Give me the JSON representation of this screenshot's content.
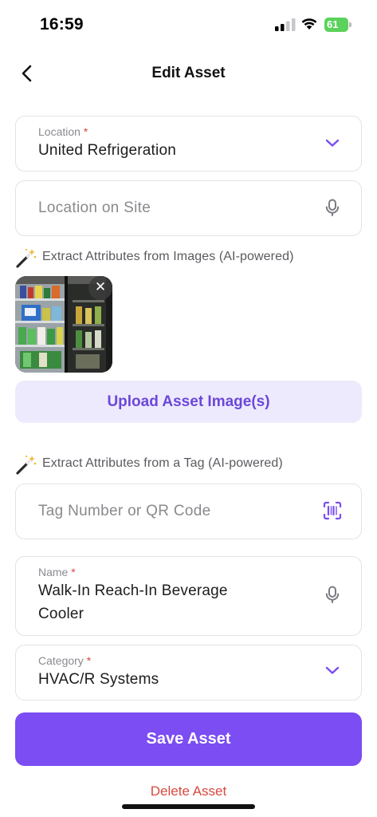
{
  "status_bar": {
    "time": "16:59",
    "battery": "61"
  },
  "nav": {
    "title": "Edit Asset"
  },
  "location": {
    "label": "Location",
    "required_mark": "*",
    "value": "United Refrigeration"
  },
  "location_on_site": {
    "placeholder": "Location on Site"
  },
  "extract_images": {
    "label": "Extract Attributes from Images (AI-powered)"
  },
  "thumbnail": {
    "remove_symbol": "✕"
  },
  "upload": {
    "label": "Upload Asset Image(s)"
  },
  "extract_tag": {
    "label": "Extract Attributes from a Tag (AI-powered)"
  },
  "tag": {
    "placeholder": "Tag Number or QR Code"
  },
  "name": {
    "label": "Name",
    "required_mark": "*",
    "value_line1": "Walk-In Reach-In Beverage",
    "value_line2": "Cooler"
  },
  "category": {
    "label": "Category",
    "required_mark": "*",
    "value": "HVAC/R Systems"
  },
  "actions": {
    "save_label": "Save Asset",
    "delete_label": "Delete Asset"
  },
  "colors": {
    "accent": "#7b4df2",
    "accent_light": "#eeeafd",
    "danger": "#d8483f",
    "required": "#e0463f"
  },
  "icons": {
    "back": "chevron-left-icon",
    "dropdown": "chevron-down-icon",
    "mic": "microphone-icon",
    "scan": "qr-scan-icon",
    "wand": "magic-wand-icon"
  }
}
